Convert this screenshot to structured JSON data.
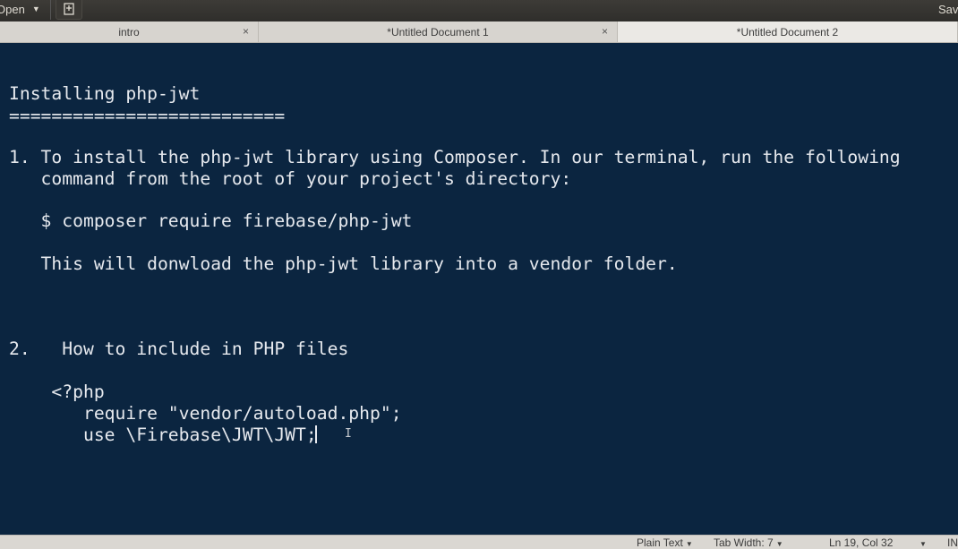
{
  "header": {
    "open_label": "Open",
    "save_label": "Save"
  },
  "tabs": [
    {
      "label": "intro",
      "closable": true
    },
    {
      "label": "*Untitled Document 1",
      "closable": true
    },
    {
      "label": "*Untitled Document 2",
      "closable": false,
      "active": true
    }
  ],
  "editor": {
    "lines": [
      "Installing php-jwt",
      "==========================",
      "1. To install the php-jwt library using Composer. In our terminal, run the following",
      "   command from the root of your project's directory:",
      "   $ composer require firebase/php-jwt",
      "   This will donwload the php-jwt library into a vendor folder.",
      "2.   How to include in PHP files",
      "    <?php",
      "       require \"vendor/autoload.php\";",
      "       use \\Firebase\\JWT\\JWT;"
    ]
  },
  "status": {
    "language": "Plain Text",
    "tab_width": "Tab Width: 7",
    "position": "Ln 19, Col 32",
    "mode": "INS"
  },
  "colors": {
    "editor_bg": "#0b2540",
    "editor_text": "#e6e9ee"
  }
}
